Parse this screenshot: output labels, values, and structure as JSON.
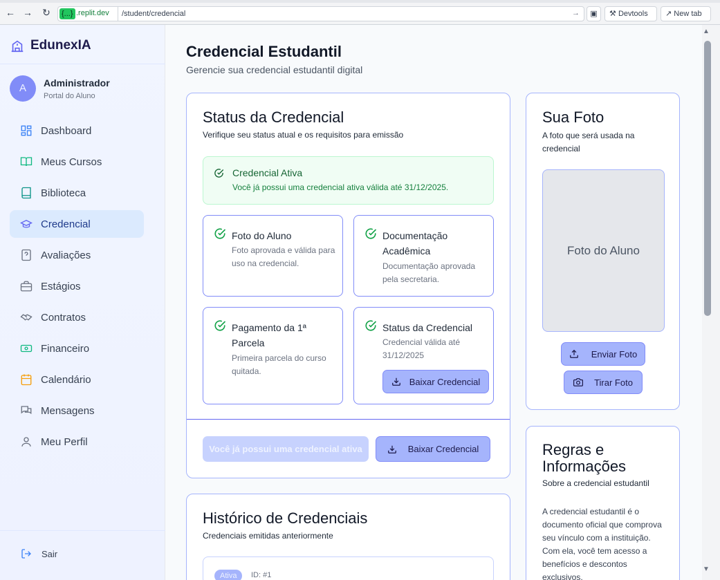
{
  "browser": {
    "url_badge": "{...}",
    "url_host": ".replit.dev",
    "url_path": "/student/credencial",
    "devtools_label": "Devtools",
    "newtab_label": "New tab"
  },
  "sidebar": {
    "brand": "EdunexIA",
    "user": {
      "avatar_letter": "A",
      "name": "Administrador",
      "role": "Portal do Aluno"
    },
    "items": [
      {
        "label": "Dashboard",
        "icon": "grid-icon",
        "active": false
      },
      {
        "label": "Meus Cursos",
        "icon": "book-open-icon",
        "active": false
      },
      {
        "label": "Biblioteca",
        "icon": "book-icon",
        "active": false
      },
      {
        "label": "Credencial",
        "icon": "graduation-cap-icon",
        "active": true
      },
      {
        "label": "Avaliações",
        "icon": "question-file-icon",
        "active": false
      },
      {
        "label": "Estágios",
        "icon": "briefcase-icon",
        "active": false
      },
      {
        "label": "Contratos",
        "icon": "handshake-icon",
        "active": false
      },
      {
        "label": "Financeiro",
        "icon": "cash-icon",
        "active": false
      },
      {
        "label": "Calendário",
        "icon": "calendar-icon",
        "active": false
      },
      {
        "label": "Mensagens",
        "icon": "messages-icon",
        "active": false
      },
      {
        "label": "Meu Perfil",
        "icon": "user-icon",
        "active": false
      }
    ],
    "logout_label": "Sair"
  },
  "page": {
    "title": "Credencial Estudantil",
    "subtitle": "Gerencie sua credencial estudantil digital"
  },
  "status_card": {
    "title": "Status da Credencial",
    "subtitle": "Verifique seu status atual e os requisitos para emissão",
    "alert_title": "Credencial Ativa",
    "alert_text": "Você já possui uma credencial ativa válida até 31/12/2025.",
    "requirements": [
      {
        "title": "Foto do Aluno",
        "description": "Foto aprovada e válida para uso na credencial."
      },
      {
        "title": "Documentação Acadêmica",
        "description": "Documentação aprovada pela secretaria."
      },
      {
        "title": "Pagamento da 1ª Parcela",
        "description": "Primeira parcela do curso quitada."
      },
      {
        "title": "Status da Credencial",
        "description": "Credencial válida até 31/12/2025",
        "button": "Baixar Credencial"
      }
    ],
    "disabled_button": "Você já possui uma credencial ativa",
    "download_button": "Baixar Credencial"
  },
  "photo_card": {
    "title": "Sua Foto",
    "subtitle": "A foto que será usada na credencial",
    "placeholder": "Foto do Aluno",
    "upload_button": "Enviar Foto",
    "camera_button": "Tirar Foto"
  },
  "rules_card": {
    "title": "Regras e Informações",
    "subtitle": "Sobre a credencial estudantil",
    "body": "A credencial estudantil é o documento oficial que comprova seu vínculo com a instituição. Com ela, você tem acesso a benefícios e descontos exclusivos."
  },
  "history_card": {
    "title": "Histórico de Credenciais",
    "subtitle": "Credenciais emitidas anteriormente",
    "rows": [
      {
        "badge": "Ativa",
        "id": "ID: #1"
      }
    ]
  },
  "colors": {
    "accent": "#6366f1",
    "card_border": "#a5b4fc",
    "success": "#16a34a",
    "sidebar_active": "#dbeafe"
  }
}
